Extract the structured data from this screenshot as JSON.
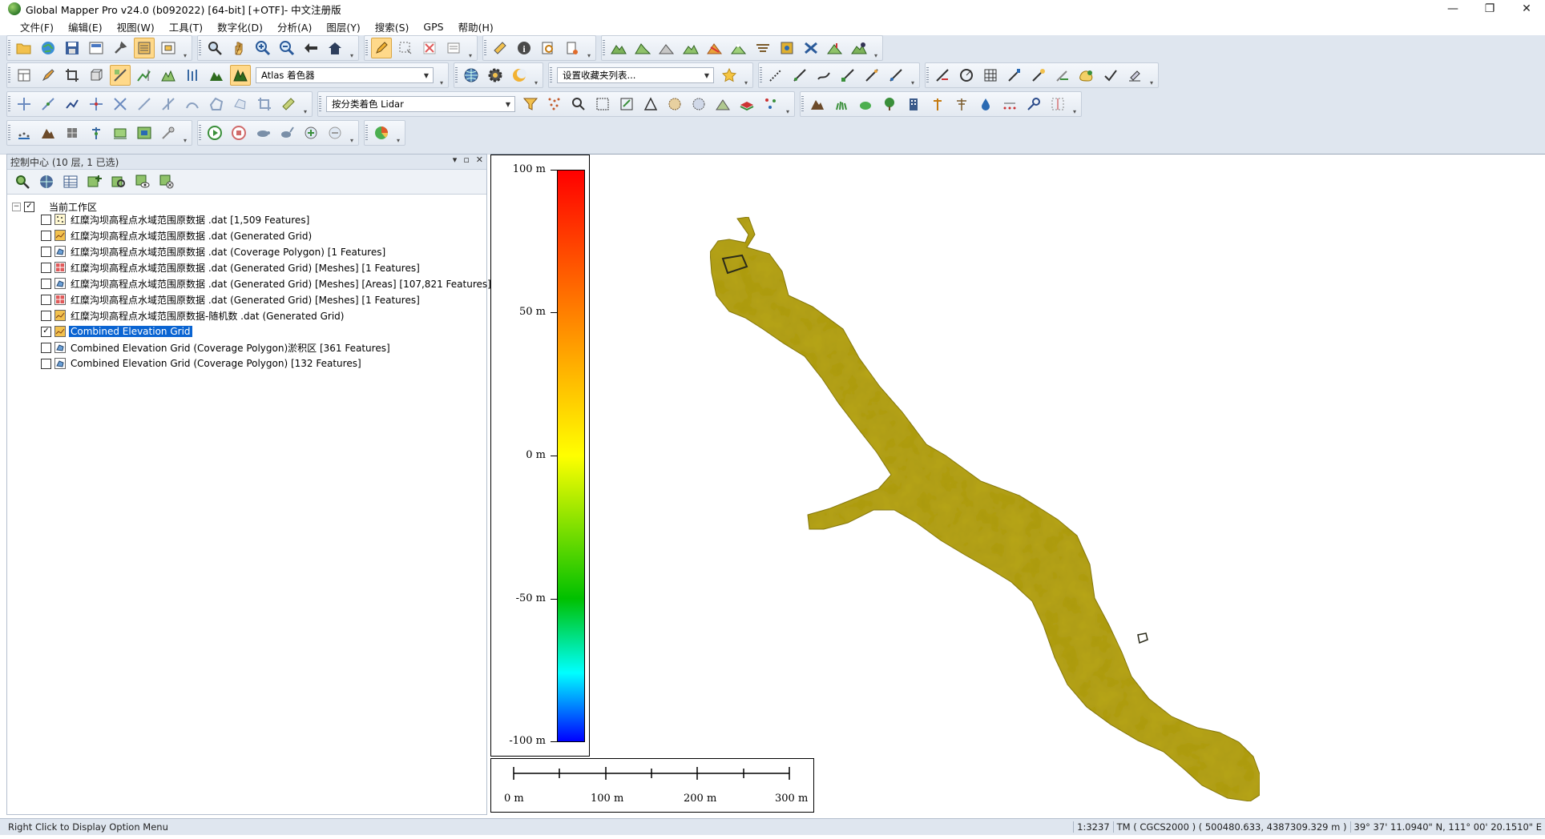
{
  "window": {
    "title": "Global Mapper Pro v24.0 (b092022) [64-bit] [+OTF]- 中文注册版",
    "minimize_glyph": "—",
    "restore_glyph": "❐",
    "close_glyph": "✕"
  },
  "menu": [
    "文件(F)",
    "编辑(E)",
    "视图(W)",
    "工具(T)",
    "数字化(D)",
    "分析(A)",
    "图层(Y)",
    "搜索(S)",
    "GPS",
    "帮助(H)"
  ],
  "toolbars": {
    "shader_combo": "Atlas 着色器",
    "favorites_combo": "设置收藏夹列表...",
    "lidar_combo": "按分类着色 Lidar",
    "icons_row1_group1": [
      "open-folder",
      "globe",
      "save",
      "export",
      "tools",
      "layers",
      "overview"
    ],
    "icons_row1_group2": [
      "zoom",
      "pan",
      "zoom-in",
      "zoom-out",
      "back",
      "home"
    ],
    "icons_row1_group3": [
      "digitize-pencil",
      "select-rect",
      "delete",
      "attributes"
    ],
    "icons_row1_group4": [
      "measure",
      "info",
      "search-feature",
      "path-profile"
    ],
    "icons_row1_group5": [
      "terrain",
      "terrain-2",
      "terrain-3",
      "terrain-4",
      "watershed",
      "contour",
      "view-shed",
      "satellite",
      "volume",
      "elevation",
      "terrain-edit"
    ],
    "icons_row2_group1": [
      "layout",
      "paint",
      "crop",
      "3d-view",
      "stretch",
      "vertical-scale",
      "lidar",
      "lidar-2",
      "hill",
      "atlas-shader"
    ],
    "icons_row2_group2": [
      "globe-config",
      "gear",
      "moon"
    ],
    "icons_row2_group3": [
      "star"
    ],
    "icons_row2_group4": [
      "line-tool",
      "line-tool-2",
      "line-tool-3",
      "line-tool-4",
      "line-tool-5",
      "line-tool-6"
    ],
    "icons_row2_group5": [
      "vector-edit",
      "circle",
      "grid",
      "brush",
      "erase",
      "eraser",
      "shape",
      "check",
      "edit-feature"
    ],
    "icons_row3_group1": [
      "move",
      "add-vertex",
      "connect",
      "move-vertex",
      "remove-vertex",
      "line",
      "split",
      "join",
      "polygon",
      "polygon-2",
      "crop-tool",
      "ruler"
    ],
    "icons_row3_group2": [
      "filter",
      "lidar-points",
      "lidar-search",
      "lidar-grid",
      "lidar-edit",
      "triangle",
      "lidar-classify",
      "lidar-ground",
      "lidar-extract",
      "lidar-layer",
      "lidar-color"
    ],
    "icons_row3_group3": [
      "mountain",
      "grass",
      "bush",
      "tree",
      "building",
      "pole",
      "power-line",
      "water",
      "noise",
      "key",
      "compare"
    ],
    "icons_row4_group1": [
      "lidar-a",
      "lidar-b",
      "lidar-c",
      "lidar-d",
      "lidar-e",
      "lidar-f",
      "lidar-g"
    ],
    "icons_row4_group2": [
      "play",
      "stop",
      "turtle",
      "rabbit",
      "add-frame",
      "remove-frame"
    ],
    "icons_row4_group3": [
      "pie-chart"
    ]
  },
  "control_center": {
    "title": "控制中心 (10 层, 1 已选)",
    "header_controls": [
      "▾",
      "▫",
      "✕"
    ],
    "toolbar_icons": [
      "zoom-to-layer",
      "globe-view",
      "table",
      "layer-add",
      "layer-search",
      "layer-visible",
      "layer-remove"
    ],
    "root": {
      "label": "当前工作区",
      "checked": true,
      "expanded": true
    },
    "layers": [
      {
        "label": "红糜沟坝高程点水域范围原数据 .dat [1,509 Features]",
        "checked": false,
        "icon": "points-icon",
        "selected": false
      },
      {
        "label": "红糜沟坝高程点水域范围原数据 .dat (Generated Grid)",
        "checked": false,
        "icon": "grid-icon",
        "selected": false
      },
      {
        "label": "红糜沟坝高程点水域范围原数据 .dat (Coverage Polygon) [1 Features]",
        "checked": false,
        "icon": "polygon-icon",
        "selected": false
      },
      {
        "label": "红糜沟坝高程点水域范围原数据 .dat (Generated Grid) [Meshes] [1 Features]",
        "checked": false,
        "icon": "mesh-icon",
        "selected": false
      },
      {
        "label": "红糜沟坝高程点水域范围原数据 .dat (Generated Grid) [Meshes] [Areas] [107,821 Features]",
        "checked": false,
        "icon": "polygon-icon",
        "selected": false
      },
      {
        "label": "红糜沟坝高程点水域范围原数据 .dat (Generated Grid) [Meshes] [1 Features]",
        "checked": false,
        "icon": "mesh-icon",
        "selected": false
      },
      {
        "label": "红糜沟坝高程点水域范围原数据-随机数 .dat (Generated Grid)",
        "checked": false,
        "icon": "grid-icon",
        "selected": false
      },
      {
        "label": "Combined Elevation Grid",
        "checked": true,
        "icon": "grid-icon",
        "selected": true
      },
      {
        "label": "Combined Elevation Grid (Coverage Polygon)淤积区 [361 Features]",
        "checked": false,
        "icon": "polygon-icon",
        "selected": false
      },
      {
        "label": "Combined Elevation Grid (Coverage Polygon) [132 Features]",
        "checked": false,
        "icon": "polygon-icon",
        "selected": false
      }
    ]
  },
  "map": {
    "terrain_color": "#b8a615",
    "legend": {
      "labels": [
        "100 m",
        "50 m",
        "0 m",
        "-50 m",
        "-100 m"
      ],
      "values": [
        100,
        50,
        0,
        -50,
        -100
      ],
      "colors": [
        "#ff0000",
        "#ff8000",
        "#ffff00",
        "#00c000",
        "#00ffff",
        "#0000ff"
      ]
    },
    "scale_bar": {
      "labels": [
        "0 m",
        "100 m",
        "200 m",
        "300 m"
      ],
      "values": [
        0,
        100,
        200,
        300
      ]
    }
  },
  "status": {
    "hint": "Right Click to Display Option Menu",
    "scale": "1:3237",
    "projection": "TM ( CGCS2000 ) ( 500480.633, 4387309.329 m )",
    "geo": "39° 37' 11.0940\" N, 111° 00' 20.1510\" E"
  }
}
